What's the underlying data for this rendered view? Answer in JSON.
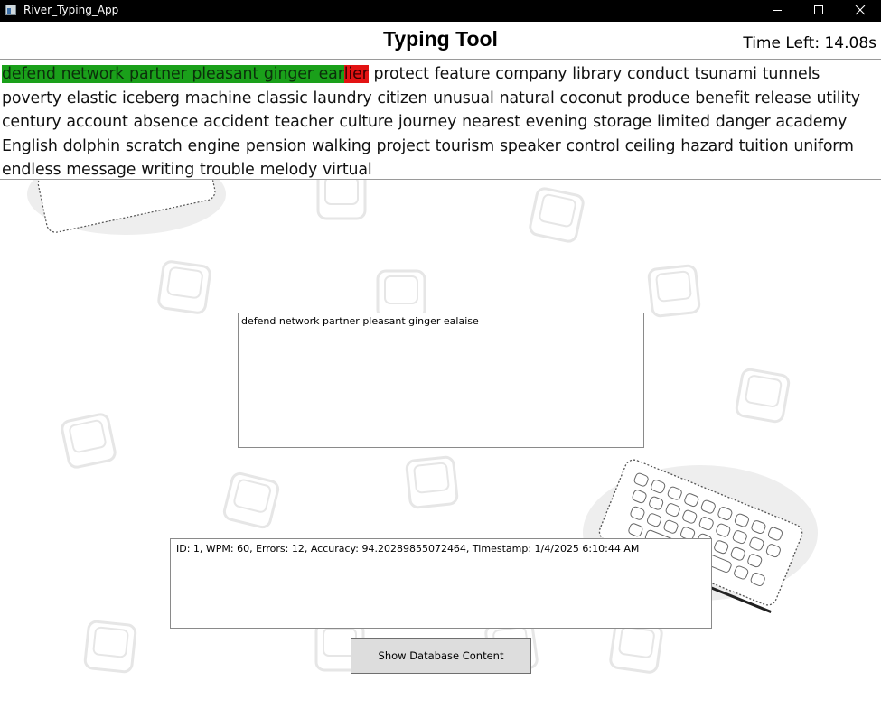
{
  "window": {
    "title": "River_Typing_App",
    "controls": [
      "minimize-icon",
      "maximize-icon",
      "close-icon"
    ]
  },
  "header": {
    "title": "Typing Tool",
    "timer": "Time Left: 14.08s"
  },
  "passage": {
    "typed_correct": "defend network partner pleasant ginger ear",
    "typed_wrong": "lier",
    "remaining": "protect feature company library conduct tsunami tunnels poverty elastic iceberg machine classic laundry citizen unusual natural coconut produce benefit release utility century account absence accident teacher culture journey nearest evening storage limited danger academy English dolphin scratch engine pension walking project tourism speaker control ceiling hazard tuition uniform endless message writing trouble melody virtual"
  },
  "input": {
    "value": "defend network partner pleasant ginger ealaise"
  },
  "results": {
    "text": "ID: 1, WPM: 60, Errors: 12, Accuracy: 94.20289855072464, Timestamp: 1/4/2025 6:10:44 AM"
  },
  "buttons": {
    "show_db": "Show Database Content"
  },
  "colors": {
    "correct": "#1aa01a",
    "wrong": "#e31313",
    "titlebar": "#000000"
  }
}
